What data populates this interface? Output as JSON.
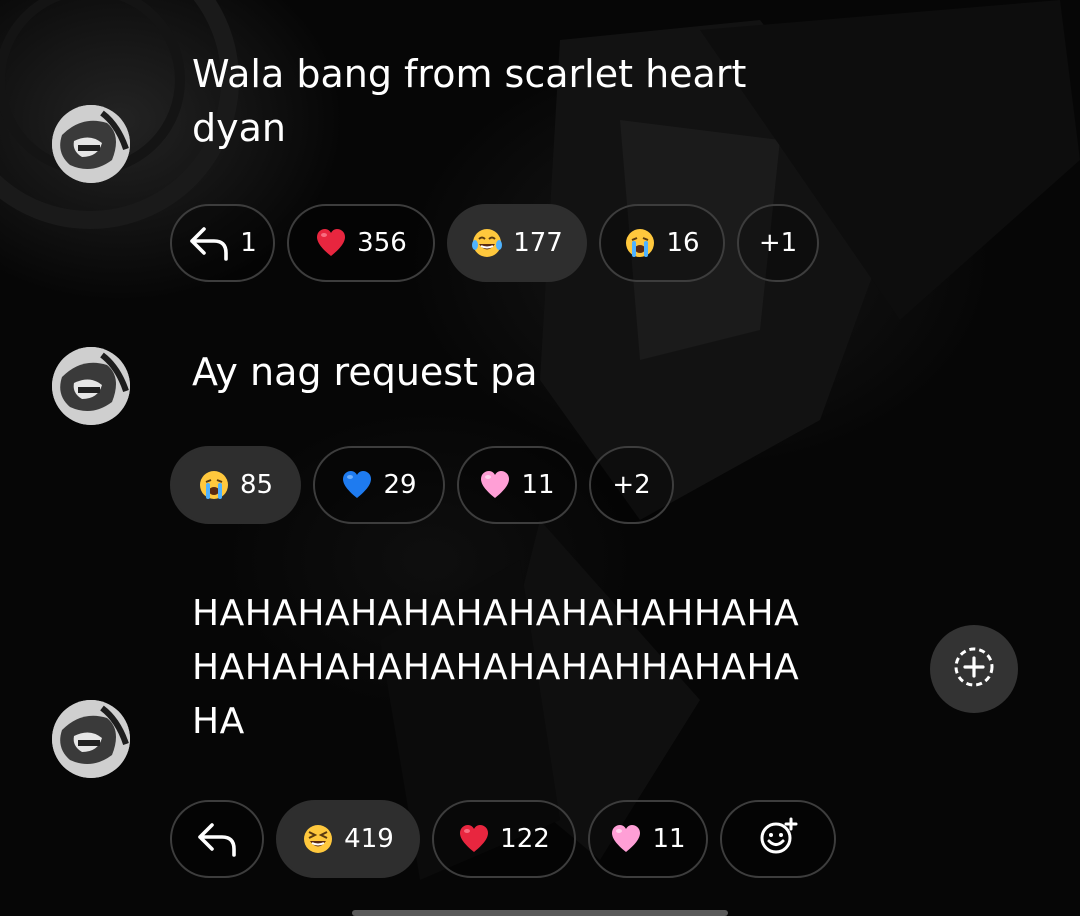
{
  "comments": [
    {
      "text": "Wala bang from scarlet heart\ndyan",
      "reply_count": "1",
      "reactions": [
        {
          "emoji": "red-heart",
          "count": "356"
        },
        {
          "emoji": "tears-of-joy",
          "count": "177"
        },
        {
          "emoji": "crying-face",
          "count": "16"
        }
      ],
      "more": "+1"
    },
    {
      "text": "Ay nag request pa",
      "reactions": [
        {
          "emoji": "crying-face",
          "count": "85"
        },
        {
          "emoji": "blue-heart",
          "count": "29"
        },
        {
          "emoji": "pink-heart",
          "count": "11"
        }
      ],
      "more": "+2"
    },
    {
      "text": "HAHAHAHAHAHAHAHAHAHHAHA\nHAHAHAHAHAHAHAHAHHAHAHA\nHA",
      "reactions": [
        {
          "emoji": "laughing-face",
          "count": "419"
        },
        {
          "emoji": "red-heart",
          "count": "122"
        },
        {
          "emoji": "pink-heart",
          "count": "11"
        }
      ]
    }
  ],
  "icons": {
    "reply": "reply-arrow-icon",
    "add_reaction": "add-reaction-icon",
    "add_story": "add-circle-icon"
  },
  "colors": {
    "pill_border": "#3d3d3d",
    "pill_active": "#2e2e2e",
    "fab": "#333333"
  }
}
